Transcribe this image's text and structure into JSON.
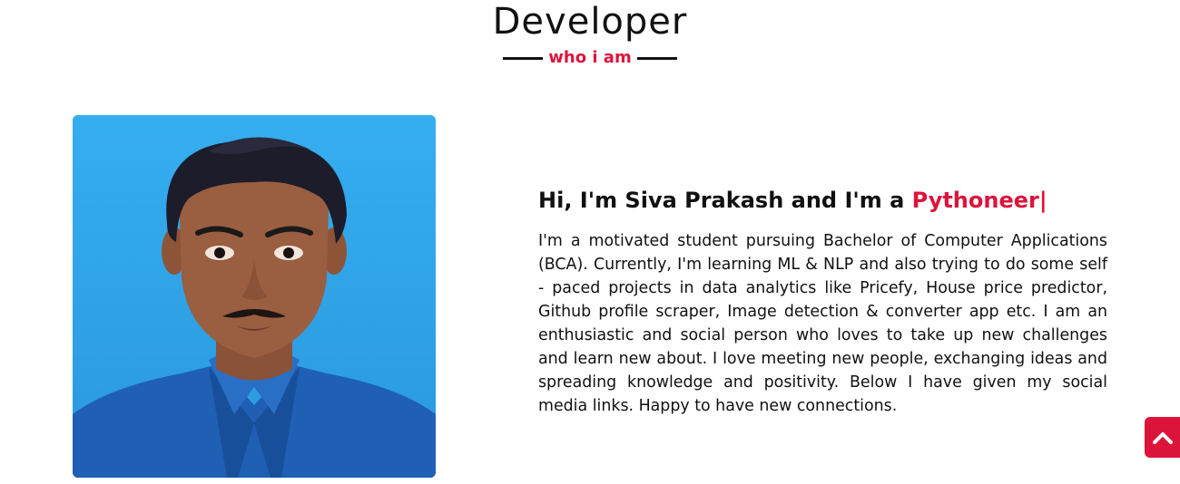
{
  "section": {
    "title": "Developer",
    "subtitle": "who i am"
  },
  "about": {
    "headline_prefix": "Hi, I'm Siva Prakash and I'm a ",
    "headline_role": "Pythoneer",
    "cursor": "|",
    "bio": "I'm a motivated student pursuing Bachelor of Computer Applications (BCA). Currently, I'm learning ML & NLP and also trying to do some self - paced projects in data analytics like Pricefy, House price predictor, Github profile scraper, Image detection & converter app etc. I am an enthusiastic and social person who loves to take up new challenges and learn new about. I love meeting new people, exchanging ideas and spreading knowledge and positivity. Below I have given my social media links. Happy to have new connections."
  },
  "colors": {
    "accent": "#dc143c",
    "text": "#111111",
    "photo_background": "#2fa6e6"
  },
  "icons": {
    "scroll_top": "chevron-up-icon"
  }
}
